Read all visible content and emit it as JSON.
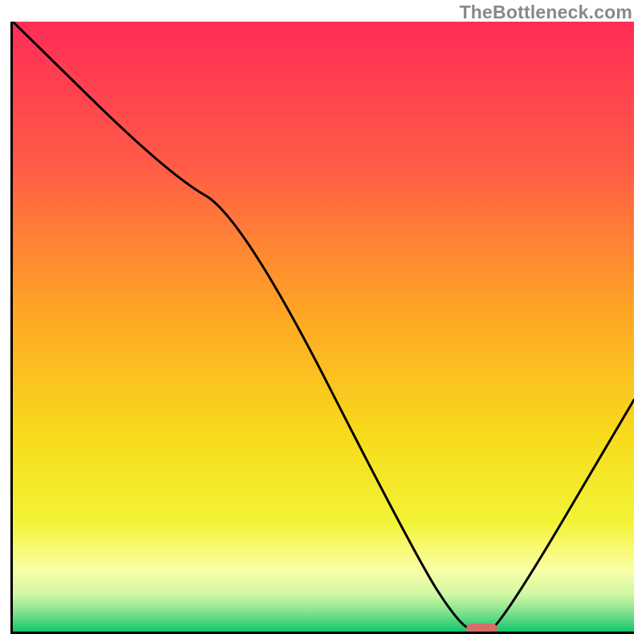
{
  "watermark": "TheBottleneck.com",
  "chart_data": {
    "type": "line",
    "title": "",
    "xlabel": "",
    "ylabel": "",
    "xlim": [
      0,
      100
    ],
    "ylim": [
      0,
      100
    ],
    "x": [
      0,
      25,
      37,
      65,
      72,
      75,
      78,
      100
    ],
    "values": [
      100,
      75,
      68,
      12,
      1,
      0,
      0,
      38
    ],
    "marker": {
      "x_start": 73,
      "x_end": 78,
      "y": 0
    },
    "gradient_stops": [
      {
        "offset": 0.0,
        "color": "#ff2c56"
      },
      {
        "offset": 0.23,
        "color": "#ff5a47"
      },
      {
        "offset": 0.48,
        "color": "#ffa724"
      },
      {
        "offset": 0.68,
        "color": "#f7db1c"
      },
      {
        "offset": 0.82,
        "color": "#f3f336"
      },
      {
        "offset": 0.9,
        "color": "#f9ffa7"
      },
      {
        "offset": 0.94,
        "color": "#cff7a3"
      },
      {
        "offset": 0.97,
        "color": "#7be08d"
      },
      {
        "offset": 1.0,
        "color": "#13c76a"
      }
    ]
  }
}
